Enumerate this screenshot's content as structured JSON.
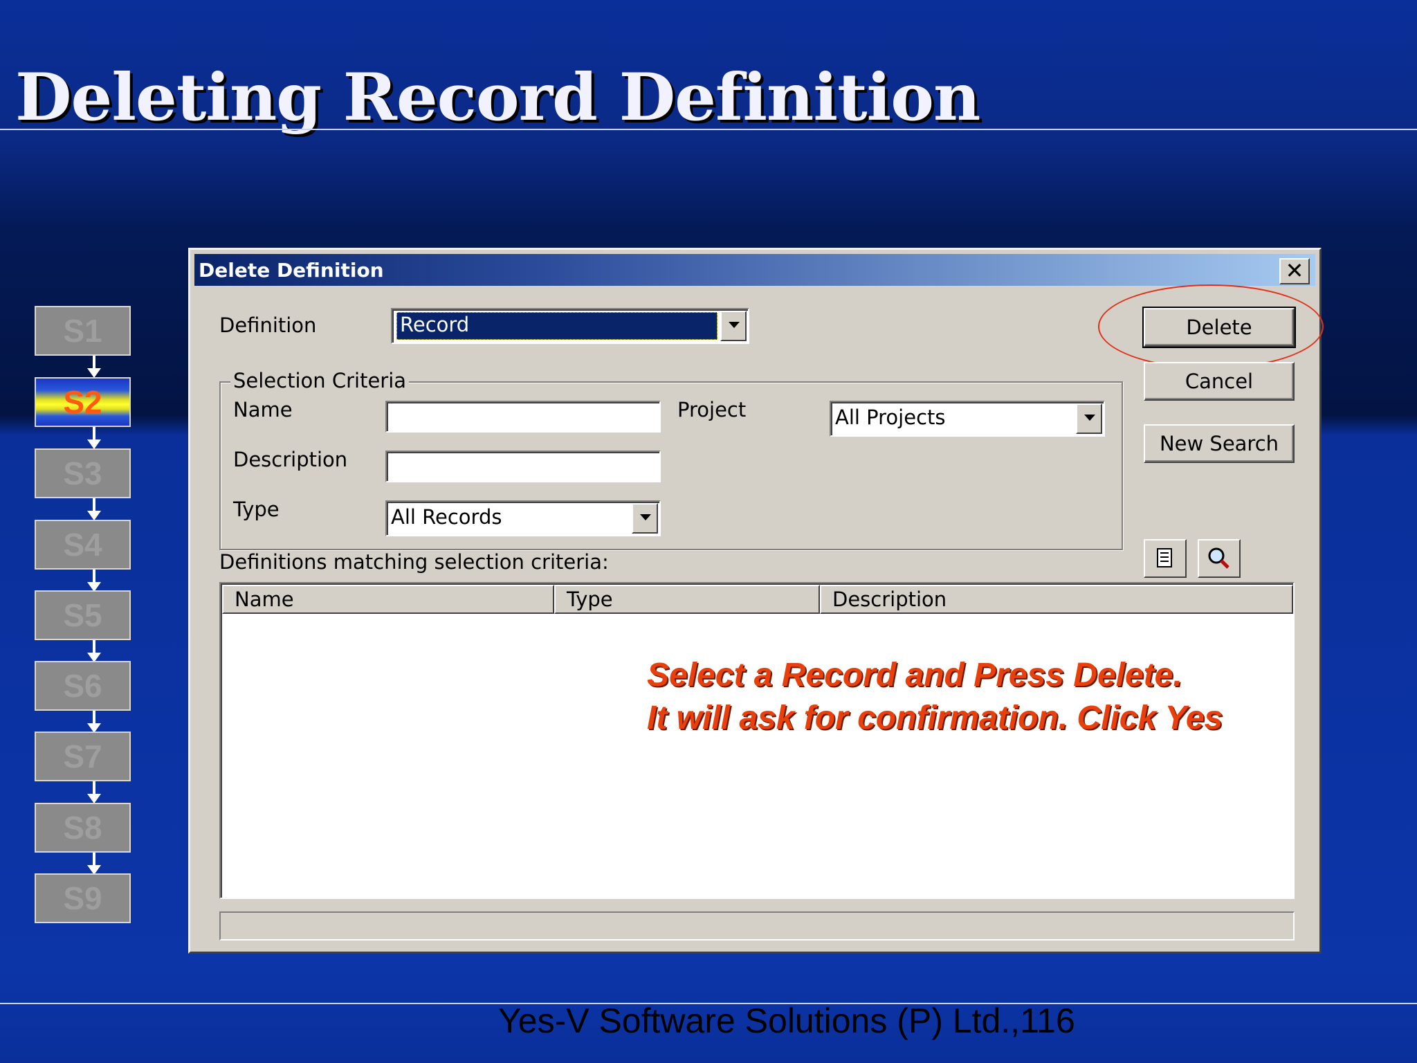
{
  "slide": {
    "title": "Deleting Record Definition",
    "footer": "Yes-V Software Solutions (P) Ltd.,116"
  },
  "steps": {
    "items": [
      "S1",
      "S2",
      "S3",
      "S4",
      "S5",
      "S6",
      "S7",
      "S8",
      "S9"
    ],
    "active": "S2"
  },
  "dialog": {
    "title": "Delete Definition",
    "close_glyph": "✕",
    "definition_label": "Definition",
    "definition_value": "Record",
    "selection_criteria_label": "Selection Criteria",
    "name_label": "Name",
    "name_value": "",
    "description_label": "Description",
    "description_value": "",
    "type_label": "Type",
    "type_value": "All Records",
    "project_label": "Project",
    "project_value": "All Projects",
    "buttons": {
      "delete": "Delete",
      "cancel": "Cancel",
      "new_search": "New Search"
    },
    "icons": [
      "list-icon",
      "magnifier-icon"
    ],
    "matching_label": "Definitions matching selection criteria:",
    "columns": [
      "Name",
      "Type",
      "Description"
    ],
    "rows": []
  },
  "annotation": {
    "line1": "Select a Record and Press Delete.",
    "line2": "It will ask for confirmation. Click Yes"
  },
  "colors": {
    "annotation": "#e8400c",
    "highlight_ellipse": "#e03018",
    "active_step_text": "#ff5a10"
  }
}
